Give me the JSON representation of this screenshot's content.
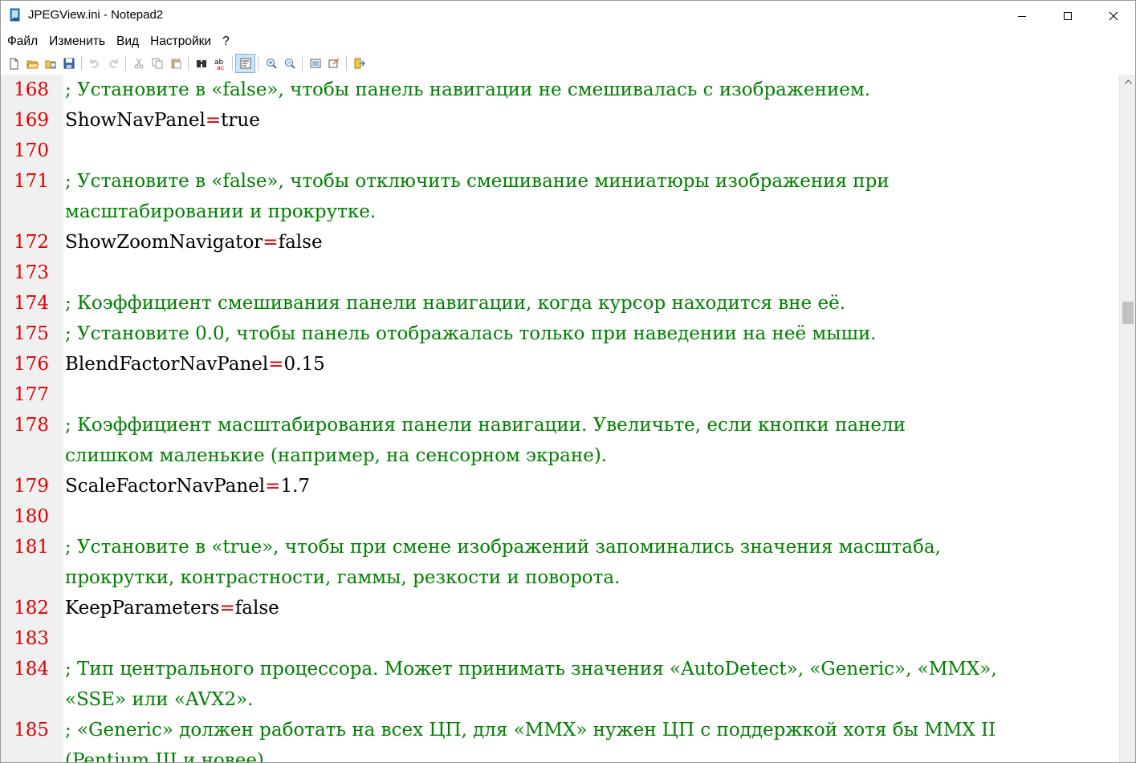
{
  "window": {
    "title": "JPEGView.ini - Notepad2"
  },
  "menu": [
    "Файл",
    "Изменить",
    "Вид",
    "Настройки",
    "?"
  ],
  "toolbar": [
    {
      "name": "new-file-icon"
    },
    {
      "name": "open-file-icon"
    },
    {
      "name": "browse-icon"
    },
    {
      "name": "save-icon"
    },
    {
      "sep": true
    },
    {
      "name": "undo-icon"
    },
    {
      "name": "redo-icon"
    },
    {
      "sep": true
    },
    {
      "name": "cut-icon"
    },
    {
      "name": "copy-icon"
    },
    {
      "name": "paste-icon"
    },
    {
      "sep": true
    },
    {
      "name": "find-icon"
    },
    {
      "name": "replace-icon"
    },
    {
      "sep": true
    },
    {
      "name": "word-wrap-icon",
      "active": true
    },
    {
      "sep": true
    },
    {
      "name": "zoom-in-icon"
    },
    {
      "name": "zoom-out-icon"
    },
    {
      "sep": true
    },
    {
      "name": "scheme-icon"
    },
    {
      "name": "customize-schemes-icon"
    },
    {
      "sep": true
    },
    {
      "name": "exit-icon"
    }
  ],
  "colors": {
    "line_number": "#e00000",
    "comment": "#008000",
    "operator": "#e00000",
    "text": "#000000",
    "gutter": "#f0f0f0"
  },
  "lines": [
    {
      "num": "168",
      "type": "comment",
      "text": "; Установите в «false», чтобы панель навигации не смешивалась с изображением."
    },
    {
      "num": "169",
      "type": "kv",
      "key": "ShowNavPanel",
      "op": "=",
      "value": "true"
    },
    {
      "num": "170",
      "type": "blank"
    },
    {
      "num": "171",
      "type": "comment",
      "text": "; Установите в «false», чтобы отключить смешивание миниатюры изображения при"
    },
    {
      "num": "",
      "type": "comment",
      "text": "масштабировании и прокрутке."
    },
    {
      "num": "172",
      "type": "kv",
      "key": "ShowZoomNavigator",
      "op": "=",
      "value": "false"
    },
    {
      "num": "173",
      "type": "blank"
    },
    {
      "num": "174",
      "type": "comment",
      "text": "; Коэффициент смешивания панели навигации, когда курсор находится вне её."
    },
    {
      "num": "175",
      "type": "comment",
      "text": "; Установите 0.0, чтобы панель отображалась только при наведении на неё мыши."
    },
    {
      "num": "176",
      "type": "kv",
      "key": "BlendFactorNavPanel",
      "op": "=",
      "value": "0.15"
    },
    {
      "num": "177",
      "type": "blank"
    },
    {
      "num": "178",
      "type": "comment",
      "text": "; Коэффициент масштабирования панели навигации. Увеличьте, если кнопки панели"
    },
    {
      "num": "",
      "type": "comment",
      "text": "слишком маленькие (например, на сенсорном экране)."
    },
    {
      "num": "179",
      "type": "kv",
      "key": "ScaleFactorNavPanel",
      "op": "=",
      "value": "1.7"
    },
    {
      "num": "180",
      "type": "blank"
    },
    {
      "num": "181",
      "type": "comment",
      "text": "; Установите в «true», чтобы при смене изображений запоминались значения масштаба,"
    },
    {
      "num": "",
      "type": "comment",
      "text": "прокрутки, контрастности, гаммы, резкости и поворота."
    },
    {
      "num": "182",
      "type": "kv",
      "key": "KeepParameters",
      "op": "=",
      "value": "false"
    },
    {
      "num": "183",
      "type": "blank"
    },
    {
      "num": "184",
      "type": "comment",
      "text": "; Тип центрального процессора. Может принимать значения «AutoDetect», «Generic», «MMX»,"
    },
    {
      "num": "",
      "type": "comment",
      "text": "«SSE» или «AVX2»."
    },
    {
      "num": "185",
      "type": "comment",
      "text": "; «Generic» должен работать на всех ЦП, для «MMX» нужен ЦП с поддержкой хотя бы MMX II"
    },
    {
      "num": "",
      "type": "comment",
      "text": "(Pentium III и новее)."
    }
  ]
}
